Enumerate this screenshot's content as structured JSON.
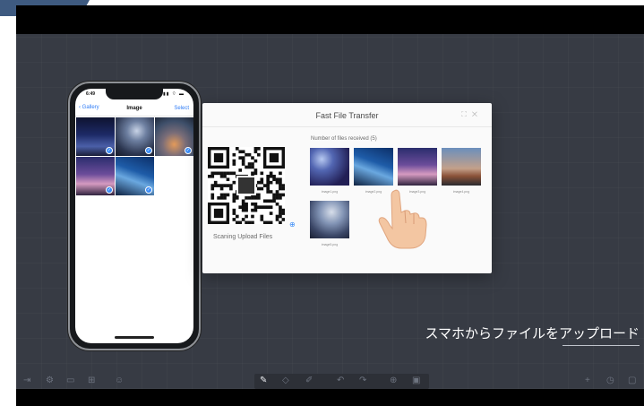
{
  "phone": {
    "time": "6:49",
    "status_icons": "▮▮ ⌔ ▬",
    "back_label": "Gallery",
    "title": "Image",
    "select_label": "Select",
    "photos": [
      {
        "style": "img-a",
        "checked": true
      },
      {
        "style": "img-b",
        "checked": true
      },
      {
        "style": "img-c",
        "checked": true
      },
      {
        "style": "img-d",
        "checked": true
      },
      {
        "style": "img-e",
        "checked": true
      }
    ]
  },
  "dialog": {
    "title": "Fast File Transfer",
    "tool_icons": [
      "fullscreen-icon",
      "close-icon"
    ],
    "scan_label": "Scaning Upload Files",
    "files_count_label": "Number of files received  (5)",
    "files": [
      {
        "name": "image1.png",
        "style": "img-f"
      },
      {
        "name": "image2.png",
        "style": "img-e"
      },
      {
        "name": "image3.png",
        "style": "img-d"
      },
      {
        "name": "image4.png",
        "style": "img-g"
      },
      {
        "name": "image5.png",
        "style": "img-h"
      }
    ]
  },
  "caption": "スマホからファイルをアップロード",
  "toolbar": {
    "left_icons": [
      "exit-icon",
      "settings-icon",
      "folder-icon",
      "apps-icon",
      "user-icon"
    ],
    "center_icons": [
      "pen-icon",
      "eraser-icon",
      "highlighter-icon",
      "undo-icon",
      "redo-icon",
      "add-icon",
      "delete-icon"
    ],
    "right_icons": [
      "plus-icon",
      "history-icon",
      "window-icon"
    ]
  },
  "colors": {
    "accent": "#3a8cf7",
    "board": "#373b44",
    "tab": "#3e5a80"
  }
}
